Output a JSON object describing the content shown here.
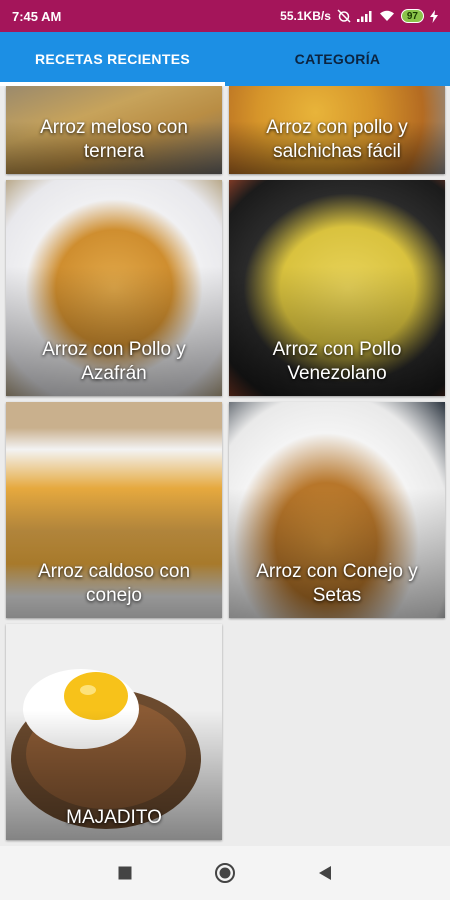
{
  "status": {
    "time": "7:45 AM",
    "network_speed": "55.1KB/s",
    "battery": "97"
  },
  "tabs": [
    {
      "label": "RECETAS RECIENTES",
      "active": true
    },
    {
      "label": "CATEGORÍA",
      "active": false
    }
  ],
  "recipes": [
    {
      "title": "Arroz meloso con ternera"
    },
    {
      "title": "Arroz con pollo y salchichas fácil"
    },
    {
      "title": "Arroz con Pollo y Azafrán"
    },
    {
      "title": "Arroz con Pollo Venezolano"
    },
    {
      "title": "Arroz caldoso con conejo"
    },
    {
      "title": "Arroz con Conejo y Setas"
    },
    {
      "title": "MAJADITO"
    }
  ],
  "nav": {
    "back_icon": "triangle-back-icon",
    "home_icon": "circle-home-icon",
    "recents_icon": "square-recents-icon"
  },
  "colors": {
    "status_bar": "#a4155a",
    "app_bar": "#1c8fe4"
  }
}
